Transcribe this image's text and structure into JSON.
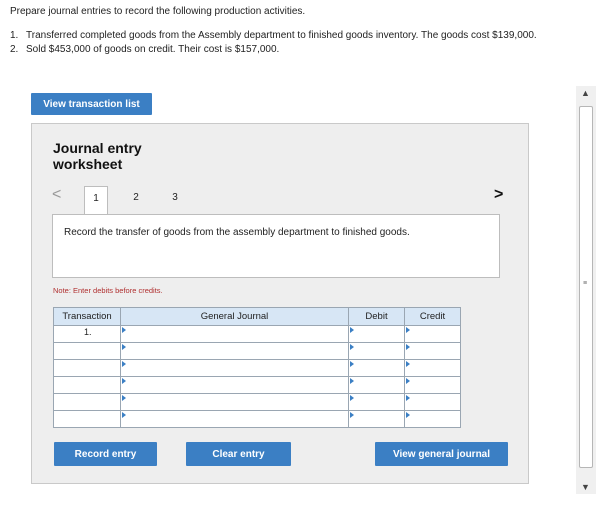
{
  "instructions": {
    "intro": "Prepare journal entries to record the following production activities.",
    "items": [
      {
        "num": "1.",
        "text": "Transferred completed goods from the Assembly department to finished goods inventory. The goods cost $139,000."
      },
      {
        "num": "2.",
        "text": "Sold $453,000 of goods on credit. Their cost is $157,000."
      }
    ]
  },
  "view_transaction_list_label": "View transaction list",
  "worksheet": {
    "title_line1": "Journal entry",
    "title_line2": "worksheet",
    "nav_prev": "<",
    "nav_next": ">",
    "tabs": [
      "1",
      "2",
      "3"
    ],
    "active_tab": "1",
    "description": "Record the transfer of goods from the assembly department to finished goods.",
    "note": "Note: Enter debits before credits.",
    "table": {
      "headers": [
        "Transaction",
        "General Journal",
        "Debit",
        "Credit"
      ],
      "rows": [
        {
          "transaction": "1.",
          "general_journal": "",
          "debit": "",
          "credit": ""
        },
        {
          "transaction": "",
          "general_journal": "",
          "debit": "",
          "credit": ""
        },
        {
          "transaction": "",
          "general_journal": "",
          "debit": "",
          "credit": ""
        },
        {
          "transaction": "",
          "general_journal": "",
          "debit": "",
          "credit": ""
        },
        {
          "transaction": "",
          "general_journal": "",
          "debit": "",
          "credit": ""
        },
        {
          "transaction": "",
          "general_journal": "",
          "debit": "",
          "credit": ""
        }
      ]
    },
    "buttons": {
      "record": "Record entry",
      "clear": "Clear entry",
      "view_general_journal": "View general journal"
    }
  },
  "scrollbar": {
    "up": "▲",
    "down": "▼",
    "grip": "≡"
  },
  "colors": {
    "accent": "#3b7fc4",
    "header_bg": "#d7e6f5",
    "note": "#b03030",
    "panel": "#eeeeee"
  }
}
